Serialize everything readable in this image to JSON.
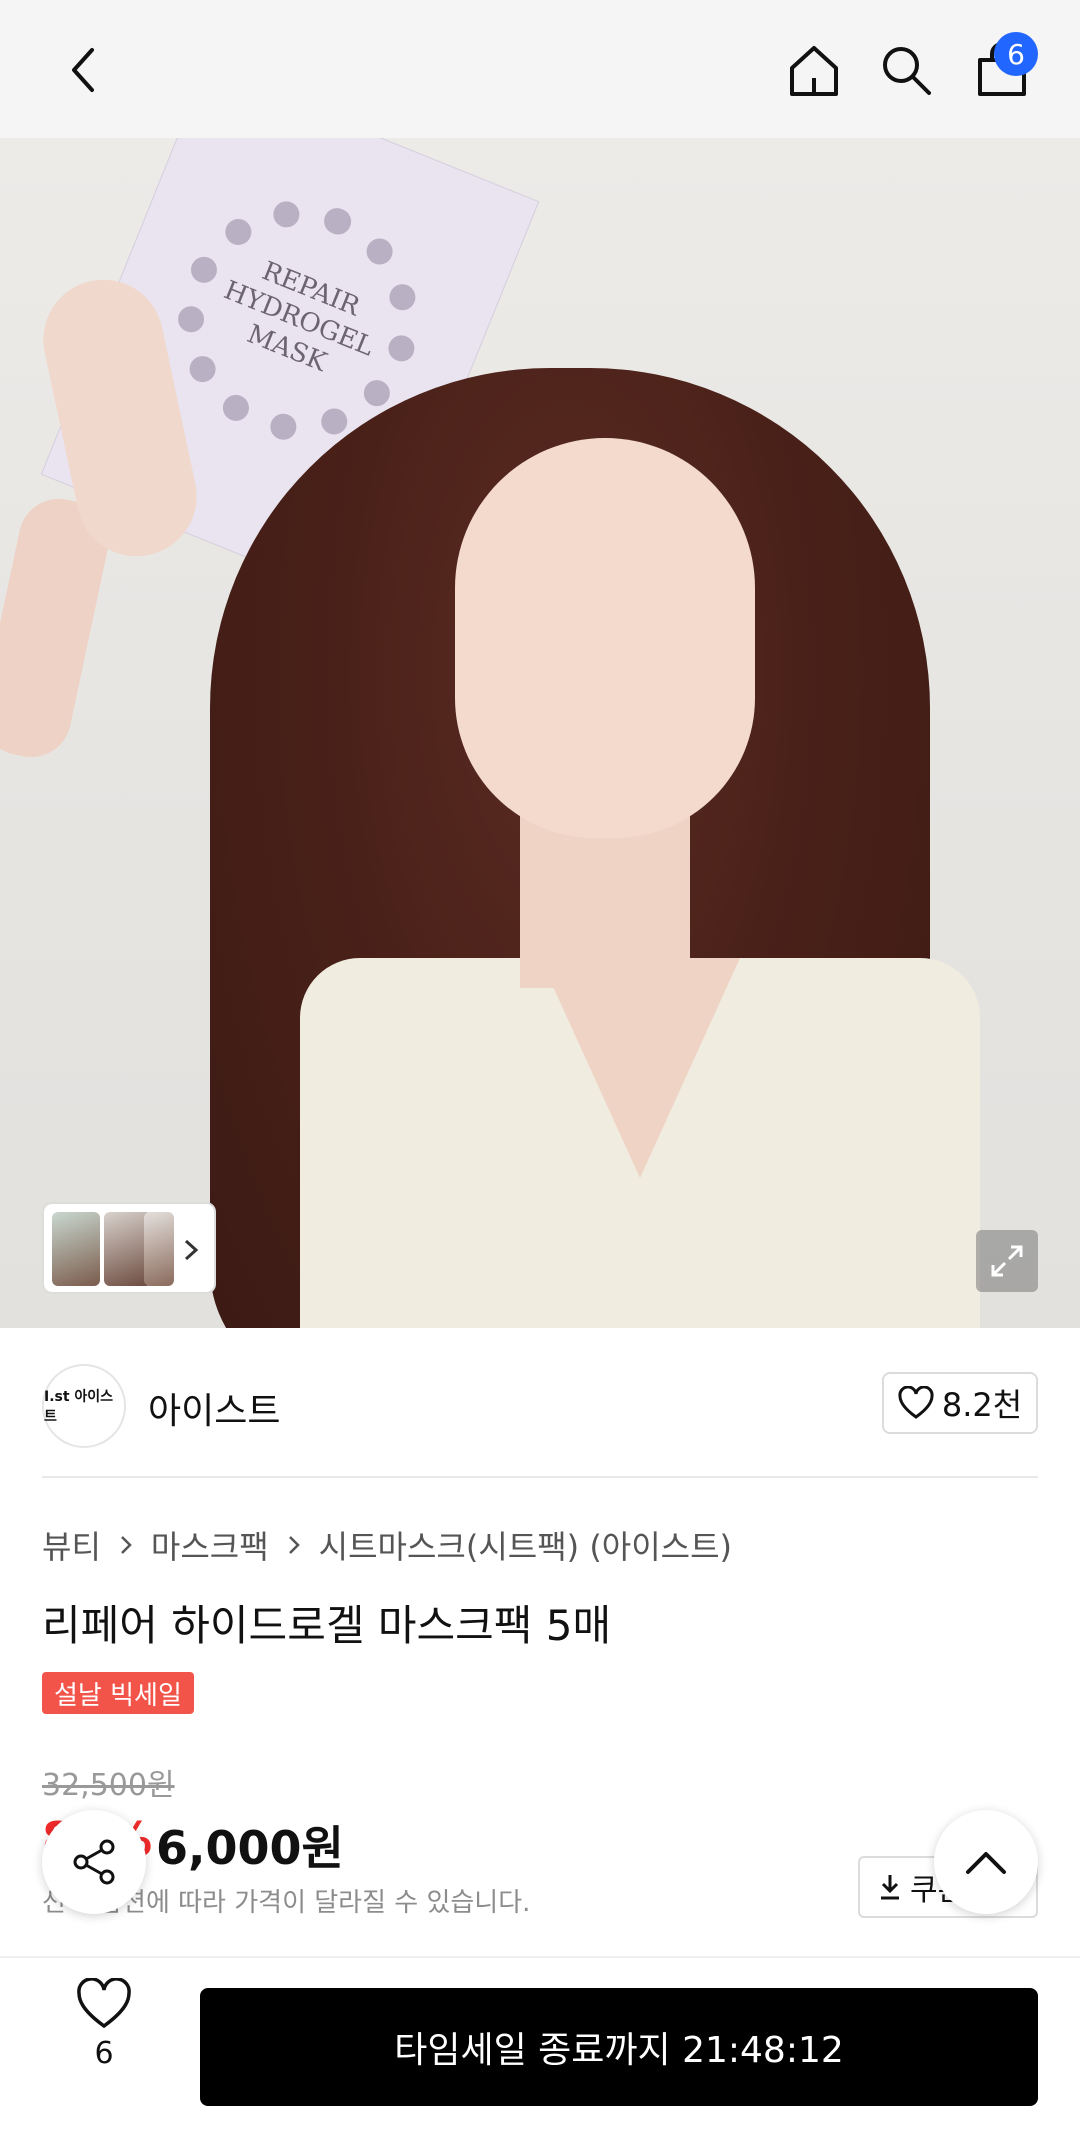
{
  "header": {
    "cart_count": "6"
  },
  "hero": {
    "box_text": "REPAIR HYDROGEL MASK"
  },
  "brand": {
    "logo_text": "I.st 아이스트",
    "name": "아이스트",
    "likes": "8.2천"
  },
  "breadcrumb": [
    "뷰티",
    "마스크팩",
    "시트마스크(시트팩) (아이스트)"
  ],
  "product": {
    "title": "리페어 하이드로겔 마스크팩 5매",
    "badge": "설날 빅세일",
    "original_price": "32,500원",
    "discount": "81%",
    "price": "6,000원",
    "price_note": "선택 옵션에 따라 가격이 달라질 수 있습니다.",
    "coupon_label": "쿠폰"
  },
  "bottom": {
    "wish_count": "6",
    "cta_label": "타임세일 종료까지 21:48:12"
  },
  "colors": {
    "accent_blue": "#2166ff",
    "sale_red": "#f3544a",
    "discount_red": "#f12a2a",
    "cta_black": "#000000"
  }
}
